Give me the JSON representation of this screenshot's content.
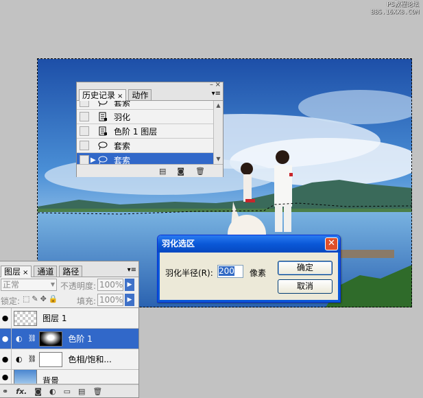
{
  "watermark": {
    "line1": "PS教程论坛",
    "line2": "BBS.16XX8.COM"
  },
  "history_panel": {
    "tabs": [
      {
        "label": "历史记录",
        "active": true
      },
      {
        "label": "动作",
        "active": false
      }
    ],
    "items": [
      {
        "label": "套索",
        "icon": "lasso-icon",
        "selected": false
      },
      {
        "label": "羽化",
        "icon": "document-icon",
        "selected": false
      },
      {
        "label": "色阶 1 图层",
        "icon": "document-icon",
        "selected": false
      },
      {
        "label": "套索",
        "icon": "lasso-icon",
        "selected": false
      },
      {
        "label": "套索",
        "icon": "lasso-icon",
        "selected": true
      }
    ]
  },
  "feather_dialog": {
    "title": "羽化选区",
    "radius_label": "羽化半径(R):",
    "radius_value": "200",
    "unit": "像素",
    "ok_label": "确定",
    "cancel_label": "取消"
  },
  "layers_panel": {
    "tabs": [
      {
        "label": "图层",
        "active": true
      },
      {
        "label": "通道",
        "active": false
      },
      {
        "label": "路径",
        "active": false
      }
    ],
    "blend_mode": "正常",
    "opacity_label": "不透明度:",
    "opacity_value": "100%",
    "lock_label": "锁定:",
    "fill_label": "填充:",
    "fill_value": "100%",
    "layers": [
      {
        "name": "图层 1",
        "selected": false
      },
      {
        "name": "色阶 1",
        "selected": true
      },
      {
        "name": "色相/饱和...",
        "selected": false
      },
      {
        "name": "背景",
        "selected": false
      }
    ],
    "footer_fx": "fx."
  },
  "colors": {
    "selection_blue": "#3168c9",
    "xp_title_blue": "#0a58d8",
    "close_red": "#e0502a"
  }
}
